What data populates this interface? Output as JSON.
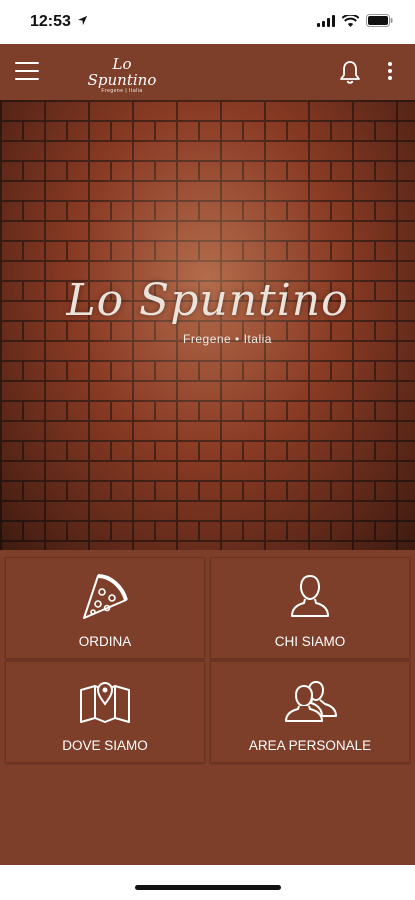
{
  "status_bar": {
    "time": "12:53"
  },
  "header": {
    "logo_name": "Lo Spuntino",
    "logo_sub": "Fregene | Italia"
  },
  "hero": {
    "logo_name": "Lo Spuntino",
    "logo_sub": "Fregene • Italia"
  },
  "tiles": [
    {
      "label": "ORDINA",
      "icon": "pizza-slice-icon"
    },
    {
      "label": "CHI SIAMO",
      "icon": "person-icon"
    },
    {
      "label": "DOVE SIAMO",
      "icon": "map-pin-icon"
    },
    {
      "label": "AREA PERSONALE",
      "icon": "people-icon"
    }
  ],
  "colors": {
    "brand": "#7e3f2a",
    "text_on_brand": "#ffffff"
  }
}
